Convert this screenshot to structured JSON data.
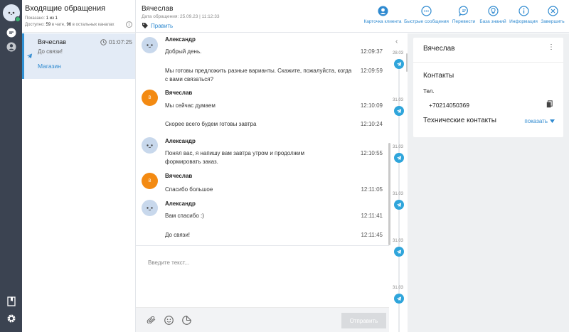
{
  "app": {
    "inbox": {
      "title": "Входящие обращения",
      "shown": "Показано: ",
      "shown_val": "1 из 1",
      "available": "Доступно: ",
      "available_chat": "59",
      "available_mid": " в чате, ",
      "available_other": "96",
      "available_tail": " в остальных каналах",
      "info_icon": "i"
    },
    "conversation_item": {
      "name": "Вячеслав",
      "time": "01:07:25",
      "preview": "До связи!",
      "channel": "Магазин"
    },
    "header": {
      "client_name": "Вячеслав",
      "date": "Дата обращения: 25.09.23 | 11:12:33",
      "edit_label": "Править",
      "tools": [
        {
          "label": "Карточка клиента",
          "icon": "user-circle-icon"
        },
        {
          "label": "Быстрые сообщения",
          "icon": "chat-dots-icon"
        },
        {
          "label": "Перевести",
          "icon": "translate-icon"
        },
        {
          "label": "База знаний",
          "icon": "lightbulb-icon"
        },
        {
          "label": "Информация",
          "icon": "info-icon"
        },
        {
          "label": "Завершить",
          "icon": "close-circle-icon"
        }
      ]
    },
    "messages": [
      {
        "author": "Александр",
        "type": "agent",
        "text": "Добрый день.",
        "time": "12:09:37"
      },
      {
        "author": "",
        "type": "agent",
        "text": "Мы готовы предложить разные варианты. Скажите, пожалуйста, когда с вами связаться?",
        "time": "12:09:59"
      },
      {
        "author": "Вячеслав",
        "type": "client",
        "text": "Мы сейчас думаем",
        "time": "12:10:09"
      },
      {
        "author": "",
        "type": "client",
        "text": "Скорее всего будем готовы завтра",
        "time": "12:10:24"
      },
      {
        "author": "Александр",
        "type": "agent",
        "text": "Понял вас, я напишу вам завтра утром и продолжим формировать заказ.",
        "time": "12:10:55"
      },
      {
        "author": "Вячеслав",
        "type": "client",
        "text": "Спасибо большое",
        "time": "12:11:05"
      },
      {
        "author": "Александр",
        "type": "agent",
        "text": "Вам спасибо :)",
        "time": "12:11:41"
      },
      {
        "author": "",
        "type": "agent",
        "text": "До связи!",
        "time": "12:11:45"
      }
    ],
    "client_avatar_letter": "В",
    "timeline": {
      "dates": [
        "28.03",
        "31.03",
        "31.03",
        "31.03",
        "31.03",
        "31.03"
      ]
    },
    "client_card": {
      "name": "Вячеслав",
      "menu": "⋮",
      "contacts_heading": "Контакты",
      "phone_label": "Тел.",
      "phone": "+70214050369",
      "tech_heading": "Технические контакты",
      "show_label": "показать"
    },
    "composer": {
      "placeholder": "Введите текст...",
      "send_label": "Отправить"
    },
    "colors": {
      "accent": "#2f8ad0",
      "rail": "#3b4351",
      "client_avatar": "#f38a12",
      "telegram": "#2fa5db",
      "selected_item": "#e3ebf6"
    }
  }
}
